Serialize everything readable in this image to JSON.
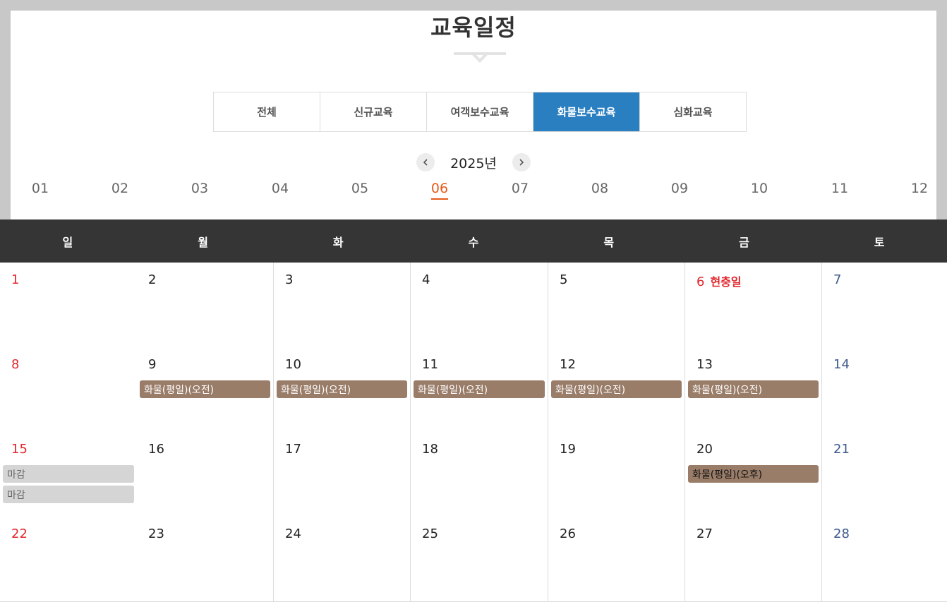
{
  "header": {
    "title": "교육일정"
  },
  "tabs": [
    {
      "label": "전체",
      "active": false
    },
    {
      "label": "신규교육",
      "active": false
    },
    {
      "label": "여객보수교육",
      "active": false
    },
    {
      "label": "화물보수교육",
      "active": true
    },
    {
      "label": "심화교육",
      "active": false
    }
  ],
  "year": {
    "label": "2025년"
  },
  "months": [
    "01",
    "02",
    "03",
    "04",
    "05",
    "06",
    "07",
    "08",
    "09",
    "10",
    "11",
    "12"
  ],
  "active_month": "06",
  "weekdays": [
    "일",
    "월",
    "화",
    "수",
    "목",
    "금",
    "토"
  ],
  "colors": {
    "accent_blue": "#2a7fc1",
    "accent_orange": "#e65a1a",
    "event_brown": "#9a7d69",
    "sunday_red": "#e0282e",
    "saturday_blue": "#3c5a8c"
  },
  "weeks": [
    {
      "days": [
        {
          "num": "1",
          "type": "sun",
          "events": []
        },
        {
          "num": "2",
          "type": "",
          "events": []
        },
        {
          "num": "3",
          "type": "",
          "events": []
        },
        {
          "num": "4",
          "type": "",
          "events": []
        },
        {
          "num": "5",
          "type": "",
          "events": []
        },
        {
          "num": "6",
          "type": "hol",
          "holiday": "현충일",
          "events": []
        },
        {
          "num": "7",
          "type": "sat",
          "events": []
        }
      ]
    },
    {
      "days": [
        {
          "num": "8",
          "type": "sun",
          "events": []
        },
        {
          "num": "9",
          "type": "",
          "events": [
            {
              "label": "화물(평일)(오전)",
              "style": "normal"
            }
          ]
        },
        {
          "num": "10",
          "type": "",
          "events": [
            {
              "label": "화물(평일)(오전)",
              "style": "normal"
            }
          ]
        },
        {
          "num": "11",
          "type": "",
          "events": [
            {
              "label": "화물(평일)(오전)",
              "style": "normal"
            }
          ]
        },
        {
          "num": "12",
          "type": "",
          "events": [
            {
              "label": "화물(평일)(오전)",
              "style": "normal"
            }
          ]
        },
        {
          "num": "13",
          "type": "",
          "events": [
            {
              "label": "화물(평일)(오전)",
              "style": "normal"
            }
          ]
        },
        {
          "num": "14",
          "type": "sat",
          "events": []
        }
      ]
    },
    {
      "days": [
        {
          "num": "15",
          "type": "sun",
          "events": [
            {
              "label": "마감",
              "style": "closed"
            },
            {
              "label": "마감",
              "style": "closed"
            }
          ]
        },
        {
          "num": "16",
          "type": "",
          "events": []
        },
        {
          "num": "17",
          "type": "",
          "events": []
        },
        {
          "num": "18",
          "type": "",
          "events": []
        },
        {
          "num": "19",
          "type": "",
          "events": []
        },
        {
          "num": "20",
          "type": "",
          "events": [
            {
              "label": "화물(평일)(오후)",
              "style": "dark"
            }
          ]
        },
        {
          "num": "21",
          "type": "sat",
          "events": []
        }
      ]
    },
    {
      "days": [
        {
          "num": "22",
          "type": "sun",
          "events": []
        },
        {
          "num": "23",
          "type": "",
          "events": []
        },
        {
          "num": "24",
          "type": "",
          "events": []
        },
        {
          "num": "25",
          "type": "",
          "events": []
        },
        {
          "num": "26",
          "type": "",
          "events": []
        },
        {
          "num": "27",
          "type": "",
          "events": []
        },
        {
          "num": "28",
          "type": "sat",
          "events": []
        }
      ]
    }
  ],
  "icons": {
    "prev": "chevron-left-icon",
    "next": "chevron-right-icon"
  }
}
